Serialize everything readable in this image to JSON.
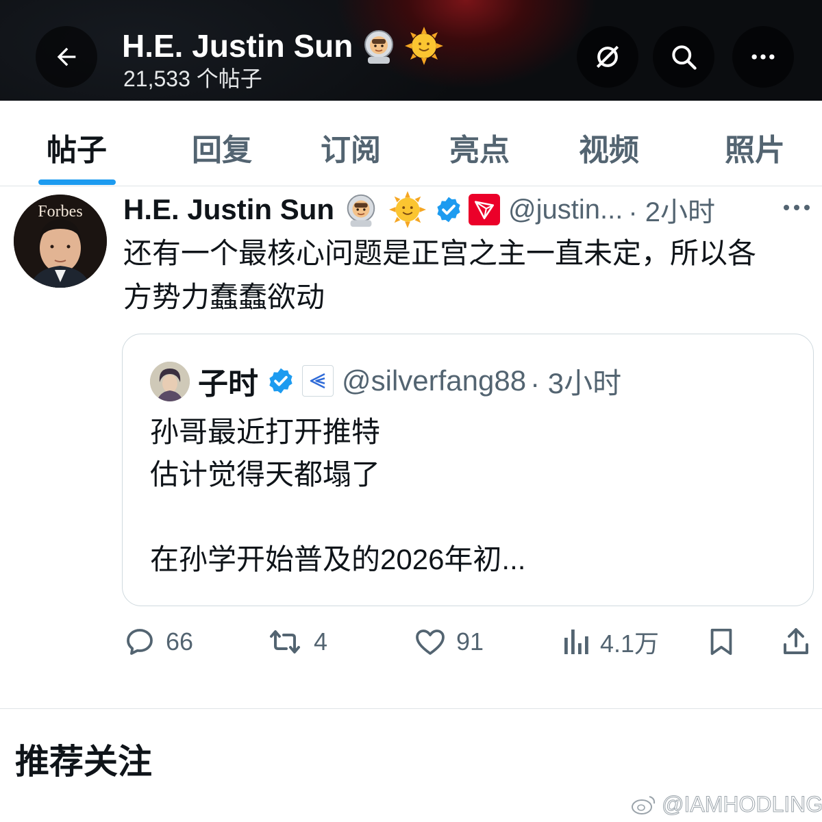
{
  "header": {
    "back_label": "back",
    "title": "H.E. Justin Sun",
    "subtitle": "21,533 个帖子",
    "icons": [
      "astronaut-emoji",
      "sun-face-emoji",
      "repost-icon",
      "search-icon",
      "more-icon"
    ]
  },
  "tabs": [
    {
      "label": "帖子",
      "active": true
    },
    {
      "label": "回复",
      "active": false
    },
    {
      "label": "订阅",
      "active": false
    },
    {
      "label": "亮点",
      "active": false
    },
    {
      "label": "视频",
      "active": false
    },
    {
      "label": "照片",
      "active": false
    }
  ],
  "post": {
    "avatar_text": "Forbes",
    "author": "H.E. Justin Sun",
    "handle": "@justin...",
    "time": "· 2小时",
    "text_line1": "还有一个最核心问题是正宫之主一直未定，所以各",
    "text_line2": "方势力蠢蠢欲动",
    "quote": {
      "author": "子时",
      "handle": "@silverfang88",
      "time": "· 3小时",
      "lines": [
        "孙哥最近打开推特",
        "估计觉得天都塌了",
        "",
        "在孙学开始普及的2026年初..."
      ]
    },
    "actions": {
      "replies": "66",
      "reposts": "4",
      "likes": "91",
      "views": "4.1万"
    }
  },
  "recommend_title": "推荐关注",
  "watermark": "@IAMHODLING",
  "colors": {
    "accent": "#1d9bf0",
    "verified": "#1d9bf0",
    "tron_red": "#eb0029",
    "secondary_text": "#536471",
    "border": "#cfd9de"
  }
}
